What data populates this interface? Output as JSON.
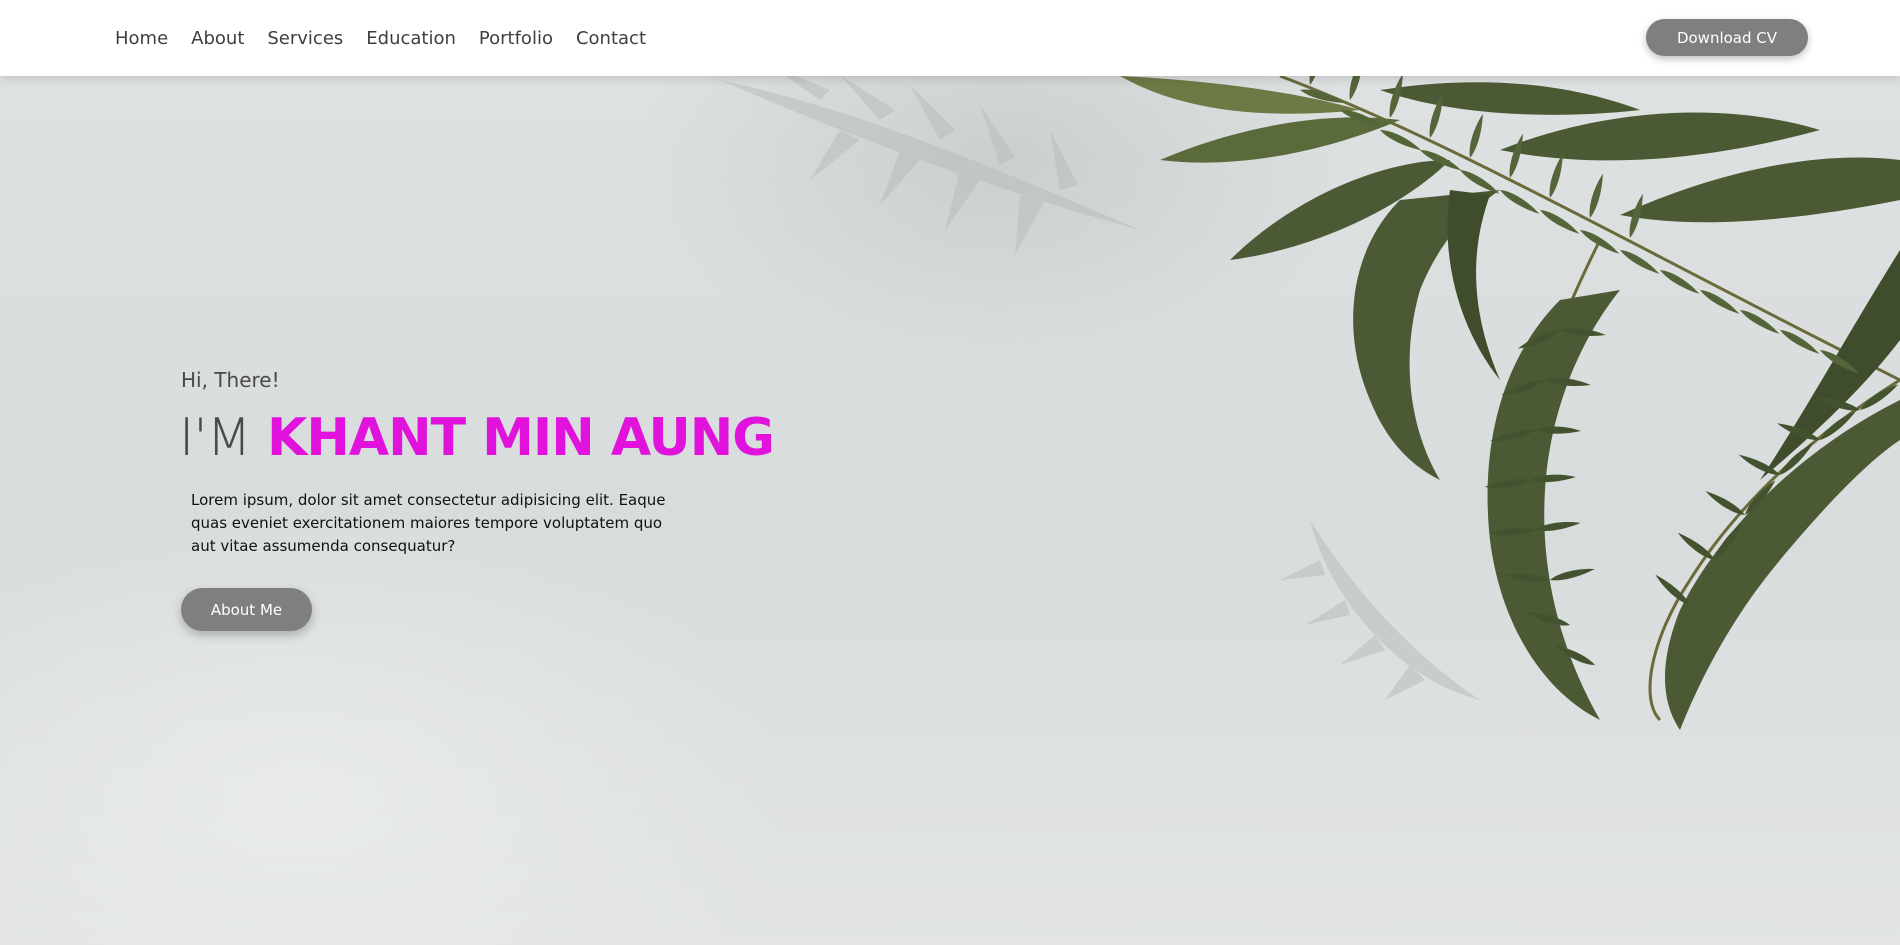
{
  "navbar": {
    "links": [
      {
        "label": "Home"
      },
      {
        "label": "About"
      },
      {
        "label": "Services"
      },
      {
        "label": "Education"
      },
      {
        "label": "Portfolio"
      },
      {
        "label": "Contact"
      }
    ],
    "download_label": "Download CV"
  },
  "hero": {
    "greeting": "Hi, There!",
    "headline_prefix": "I'M",
    "headline_name": "KHANT MIN AUNG",
    "intro": "Lorem ipsum, dolor sit amet consectetur adipisicing elit. Eaque quas eveniet exercitationem maiores tempore voluptatem quo aut vitae assumenda consequatur?",
    "about_label": "About Me"
  },
  "colors": {
    "accent_name": "#e012dc",
    "button_bg": "#7f7f7f",
    "nav_text": "#3f3f3f",
    "fern": "#4b5a34"
  }
}
